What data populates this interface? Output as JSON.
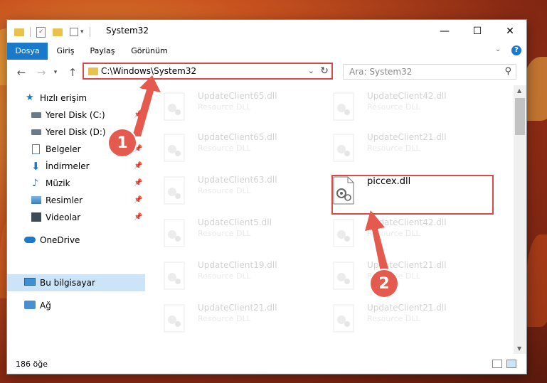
{
  "window": {
    "title": "System32",
    "controls": {
      "minimize": "—",
      "maximize": "☐",
      "close": "✕"
    }
  },
  "ribbon": {
    "tabs": [
      "Dosya",
      "Giriş",
      "Paylaş",
      "Görünüm"
    ]
  },
  "address": {
    "path": "C:\\Windows\\System32",
    "search_placeholder": "Ara: System32"
  },
  "sidebar": {
    "items": [
      {
        "label": "Hızlı erişim",
        "icon": "star-icon",
        "pinned": false
      },
      {
        "label": "Yerel Disk (C:)",
        "icon": "drive-icon",
        "pinned": true
      },
      {
        "label": "Yerel Disk (D:)",
        "icon": "drive-icon",
        "pinned": true
      },
      {
        "label": "Belgeler",
        "icon": "documents-icon",
        "pinned": true
      },
      {
        "label": "İndirmeler",
        "icon": "download-icon",
        "pinned": true
      },
      {
        "label": "Müzik",
        "icon": "music-icon",
        "pinned": true
      },
      {
        "label": "Resimler",
        "icon": "pictures-icon",
        "pinned": true
      },
      {
        "label": "Videolar",
        "icon": "video-icon",
        "pinned": true
      },
      {
        "label": "OneDrive",
        "icon": "cloud-icon",
        "pinned": false
      },
      {
        "label": "Bu bilgisayar",
        "icon": "computer-icon",
        "pinned": false,
        "selected": true
      },
      {
        "label": "Ağ",
        "icon": "network-icon",
        "pinned": false
      }
    ]
  },
  "files": [
    {
      "name": "UpdateClient65.dll",
      "type": "Resource DLL"
    },
    {
      "name": "UpdateClient42.dll",
      "type": "Resource DLL"
    },
    {
      "name": "UpdateClient65.dll",
      "type": "Resource DLL"
    },
    {
      "name": "UpdateClient21.dll",
      "type": "Resource DLL"
    },
    {
      "name": "UpdateClient63.dll",
      "type": "Resource DLL"
    },
    {
      "name": "piccex.dll",
      "type": ""
    },
    {
      "name": "UpdateClient5.dll",
      "type": "Resource DLL"
    },
    {
      "name": "UpdateClient42.dll",
      "type": "Resource DLL"
    },
    {
      "name": "UpdateClient19.dll",
      "type": "Resource DLL"
    },
    {
      "name": "UpdateClient21.dll",
      "type": "Resource DLL"
    },
    {
      "name": "UpdateClient21.dll",
      "type": "Resource DLL"
    },
    {
      "name": "UpdateClient21.dll",
      "type": "Resource DLL"
    }
  ],
  "status": {
    "count": "186 öğe"
  },
  "markers": [
    "1",
    "2"
  ],
  "colors": {
    "accent": "#1979ca",
    "highlight": "#d9494b",
    "marker": "#e55a4e",
    "selection": "#cce4f7"
  }
}
